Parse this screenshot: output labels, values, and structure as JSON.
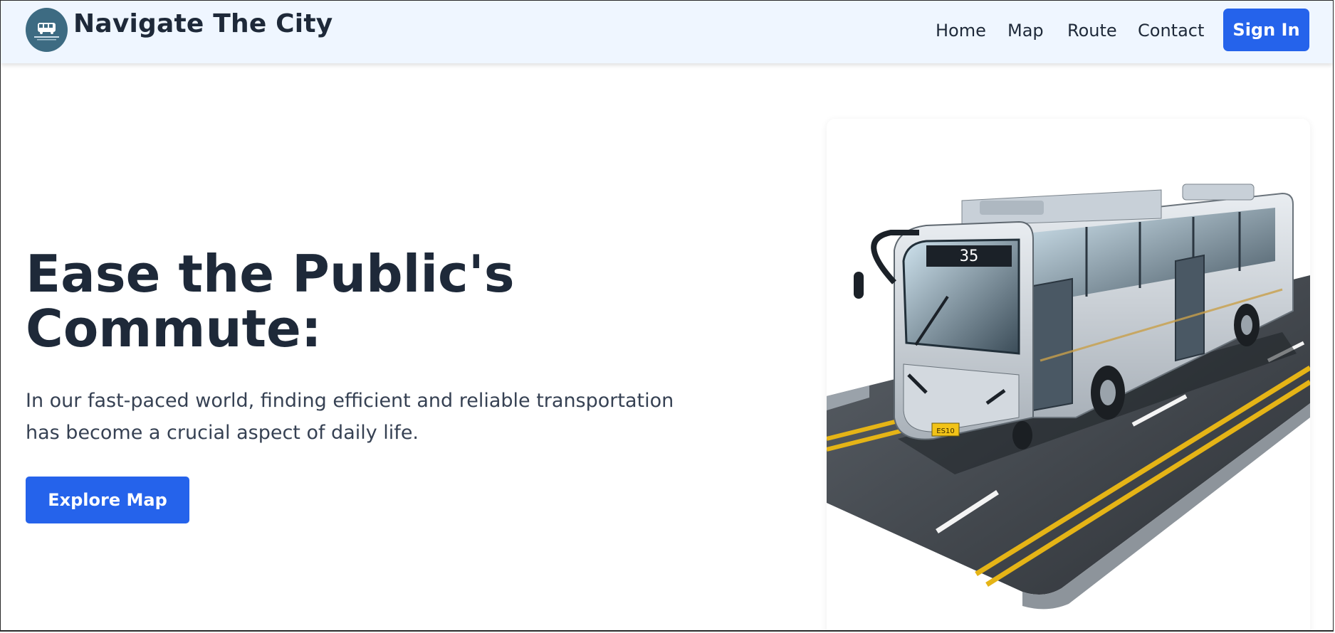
{
  "navbar": {
    "brand": "Navigate The City",
    "links": [
      "Home",
      "Map",
      "Route",
      "Contact"
    ],
    "signin_label": "Sign In"
  },
  "hero": {
    "title_line1": "Ease the Public's",
    "title_line2": "Commute:",
    "description": "In our fast-paced world, finding efficient and reliable transportation has become a crucial aspect of daily life.",
    "cta_label": "Explore Map"
  },
  "illustration": {
    "bus_route_number": "35",
    "license_plate": "ES10"
  },
  "colors": {
    "accent": "#2563eb",
    "navbar_bg": "#eff6ff",
    "heading": "#1e2939",
    "logo_bg": "#3d6b82"
  },
  "icons": {
    "logo": "bus-logo-icon"
  }
}
